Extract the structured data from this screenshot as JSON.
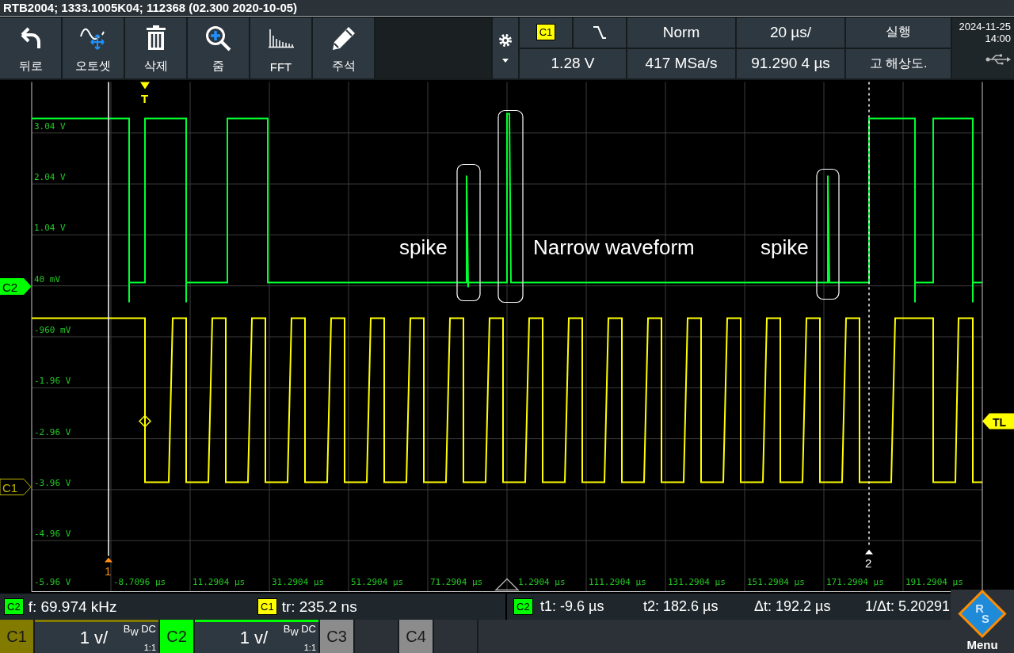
{
  "title_bar": "RTB2004; 1333.1005K04; 112368 (02.300 2020-10-05)",
  "toolbar": [
    {
      "label": "뒤로"
    },
    {
      "label": "오토셋"
    },
    {
      "label": "삭제"
    },
    {
      "label": "줌"
    },
    {
      "label": "FFT"
    },
    {
      "label": "주석"
    }
  ],
  "status_panel": {
    "trigger_source": "C1",
    "trigger_mode": "Norm",
    "timebase": "20 µs/",
    "run_state": "실행",
    "trigger_level": "1.28 V",
    "sample_rate": "417 MSa/s",
    "horizontal_position": "91.290 4 µs",
    "acquisition_mode": "고 해상도."
  },
  "clock": {
    "date": "2024-11-25",
    "time": "14:00"
  },
  "plot": {
    "y_labels": [
      "3.04 V",
      "2.04 V",
      "1.04 V",
      "40 mV",
      "-960 mV",
      "-1.96 V",
      "-2.96 V",
      "-3.96 V",
      "-4.96 V",
      "-5.96 V"
    ],
    "x_labels": [
      "-8.7096 µs",
      "11.2904 µs",
      "31.2904 µs",
      "51.2904 µs",
      "71.2904 µs",
      "1.2904 µs",
      "111.2904 µs",
      "131.2904 µs",
      "151.2904 µs",
      "171.2904 µs",
      "191.2904 µs"
    ],
    "channel_markers": [
      {
        "label": "C2",
        "color": "#00ff00",
        "selected": true
      },
      {
        "label": "C1",
        "color": "#bfb800",
        "selected": false
      }
    ],
    "trigger_marker": "T",
    "trigger_level_marker": "TL",
    "cursor_labels": [
      "1",
      "2"
    ],
    "annotations": [
      {
        "text": "spike"
      },
      {
        "text": "Narrow waveform"
      },
      {
        "text": "spike"
      }
    ]
  },
  "measurements": [
    {
      "source": "C2",
      "color": "#00ff00",
      "text": "f: 69.974 kHz"
    },
    {
      "source": "C1",
      "color": "#ffff00",
      "text": "tr: 235.2 ns"
    }
  ],
  "cursor_readout": {
    "source": "C2",
    "color": "#00ff00",
    "values": [
      "t1: -9.6 µs",
      "t2: 182.6 µs",
      "Δt: 192.2 µs",
      "1/Δt: 5.20291"
    ]
  },
  "channel_bar": [
    {
      "name": "C1",
      "color": "#827b00",
      "on": true,
      "scale": "1 v/",
      "coupling": "B$_{W}$ DC",
      "probe": "1:1"
    },
    {
      "name": "C2",
      "color": "#00ff00",
      "on": true,
      "scale": "1 v/",
      "coupling": "B$_{W}$ DC",
      "probe": "1:1"
    },
    {
      "name": "C3",
      "color": "#8c8c8c",
      "on": false
    },
    {
      "name": "C4",
      "color": "#8c8c8c",
      "on": false
    }
  ],
  "menu": {
    "label": "Menu",
    "logo_letters": [
      "R",
      "S"
    ]
  }
}
